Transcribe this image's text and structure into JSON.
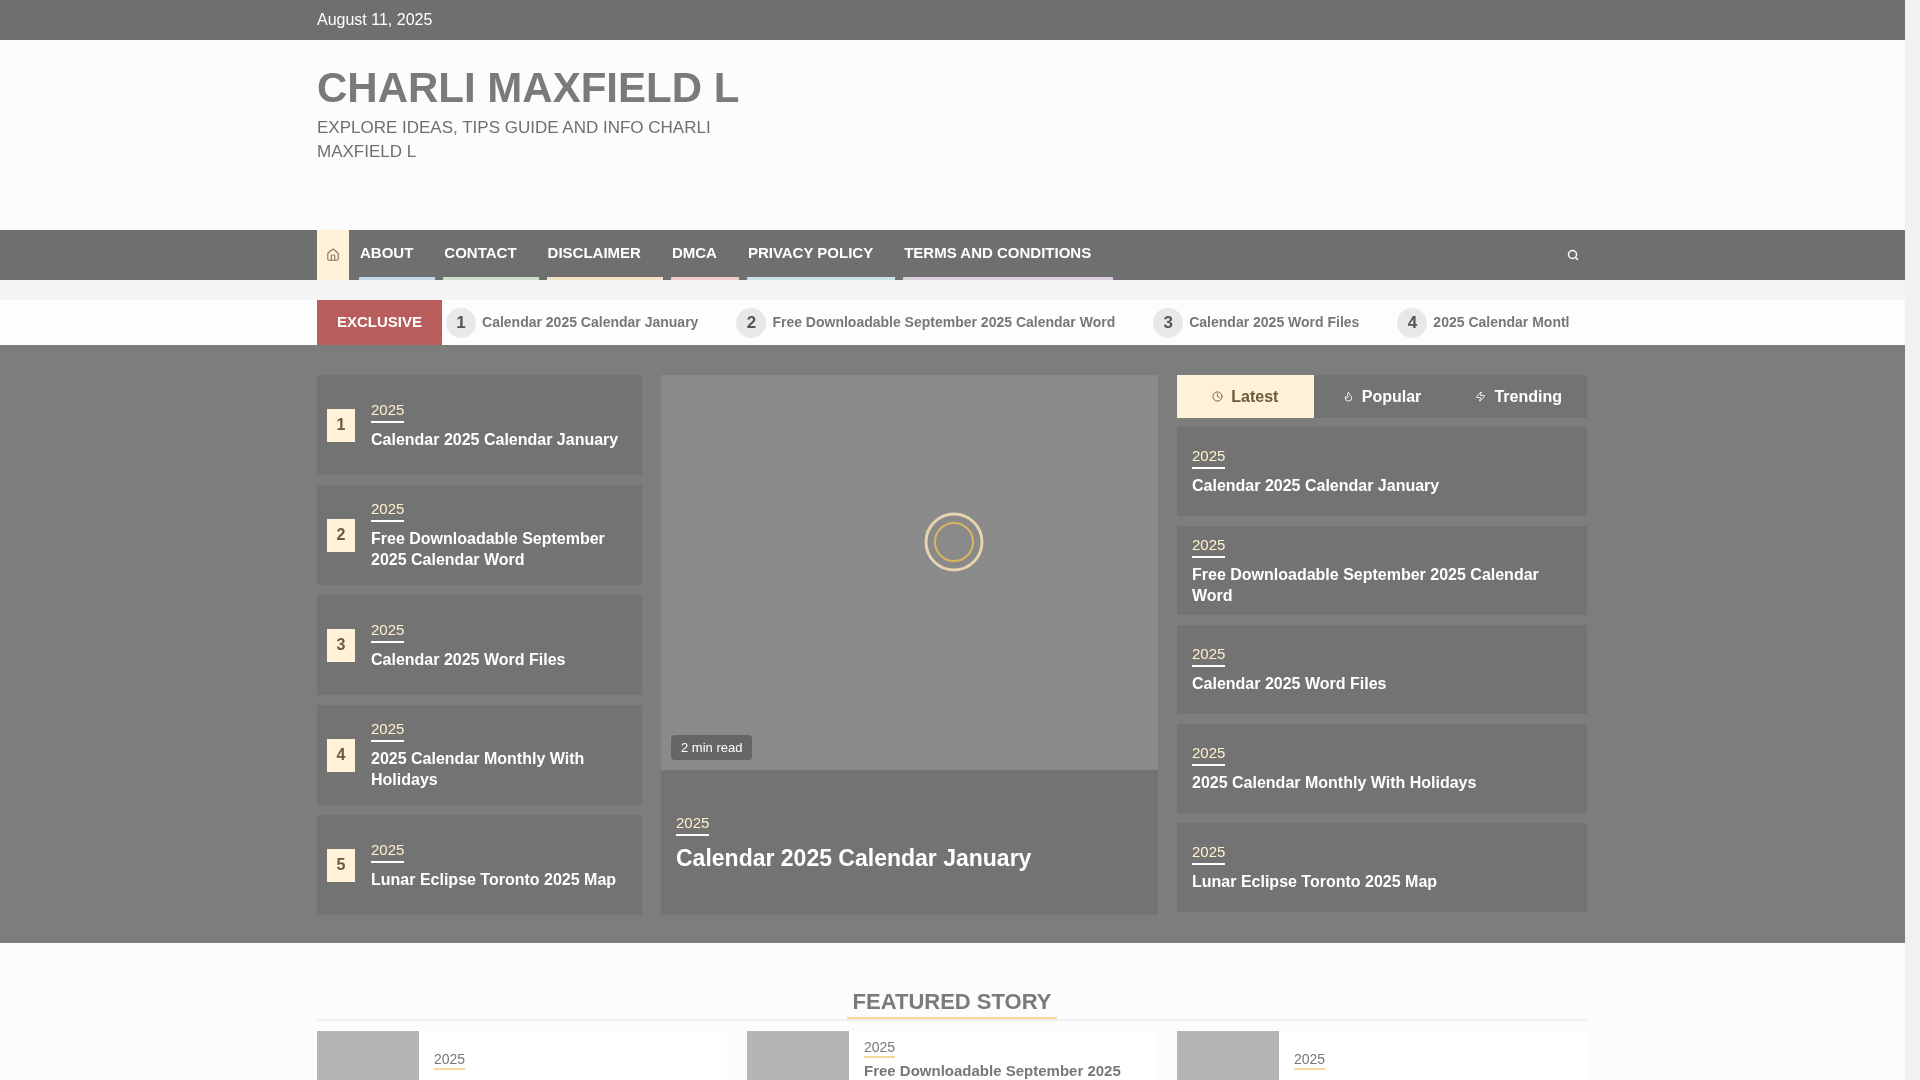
{
  "top_bar": {
    "date": "August 11, 2025"
  },
  "site": {
    "title": "CHARLI MAXFIELD L",
    "tagline": "EXPLORE IDEAS, TIPS GUIDE AND INFO CHARLI MAXFIELD L"
  },
  "nav": {
    "items": [
      {
        "label": "ABOUT",
        "color": "#c6d8e8"
      },
      {
        "label": "CONTACT",
        "color": "#cde0cd"
      },
      {
        "label": "DISCLAIMER",
        "color": "#f3e2c4"
      },
      {
        "label": "DMCA",
        "color": "#efcccc"
      },
      {
        "label": "PRIVACY POLICY",
        "color": "#c8e2e8"
      },
      {
        "label": "TERMS AND CONDITIONS",
        "color": "#dccfe0"
      }
    ]
  },
  "ticker": {
    "label": "EXCLUSIVE",
    "items": [
      {
        "number": "1",
        "title": "Calendar 2025 Calendar January"
      },
      {
        "number": "2",
        "title": "Free Downloadable September 2025 Calendar Word"
      },
      {
        "number": "3",
        "title": "Calendar 2025 Word Files"
      },
      {
        "number": "4",
        "title": "2025 Calendar Montl"
      }
    ]
  },
  "numbered_posts": [
    {
      "number": "1",
      "category": "2025",
      "title": "Calendar 2025 Calendar January"
    },
    {
      "number": "2",
      "category": "2025",
      "title": "Free Downloadable September 2025 Calendar Word"
    },
    {
      "number": "3",
      "category": "2025",
      "title": "Calendar 2025 Word Files"
    },
    {
      "number": "4",
      "category": "2025",
      "title": "2025 Calendar Monthly With Holidays"
    },
    {
      "number": "5",
      "category": "2025",
      "title": "Lunar Eclipse Toronto 2025 Map"
    }
  ],
  "featured_post": {
    "read_time": "2 min read",
    "category": "2025",
    "title": "Calendar 2025 Calendar January"
  },
  "tabs": [
    {
      "label": "Latest",
      "kind": "clock",
      "selected": true
    },
    {
      "label": "Popular",
      "kind": "flame",
      "selected": false
    },
    {
      "label": "Trending",
      "kind": "bolt",
      "selected": false
    }
  ],
  "tab_posts": [
    {
      "category": "2025",
      "title": "Calendar 2025 Calendar January"
    },
    {
      "category": "2025",
      "title": "Free Downloadable September 2025 Calendar Word"
    },
    {
      "category": "2025",
      "title": "Calendar 2025 Word Files"
    },
    {
      "category": "2025",
      "title": "2025 Calendar Monthly With Holidays"
    },
    {
      "category": "2025",
      "title": "Lunar Eclipse Toronto 2025 Map"
    }
  ],
  "featured_story": {
    "heading": "FEATURED STORY",
    "cards": [
      {
        "category": "2025"
      },
      {
        "category": "2025",
        "title": "Free Downloadable September 2025"
      },
      {
        "category": "2025"
      }
    ]
  }
}
